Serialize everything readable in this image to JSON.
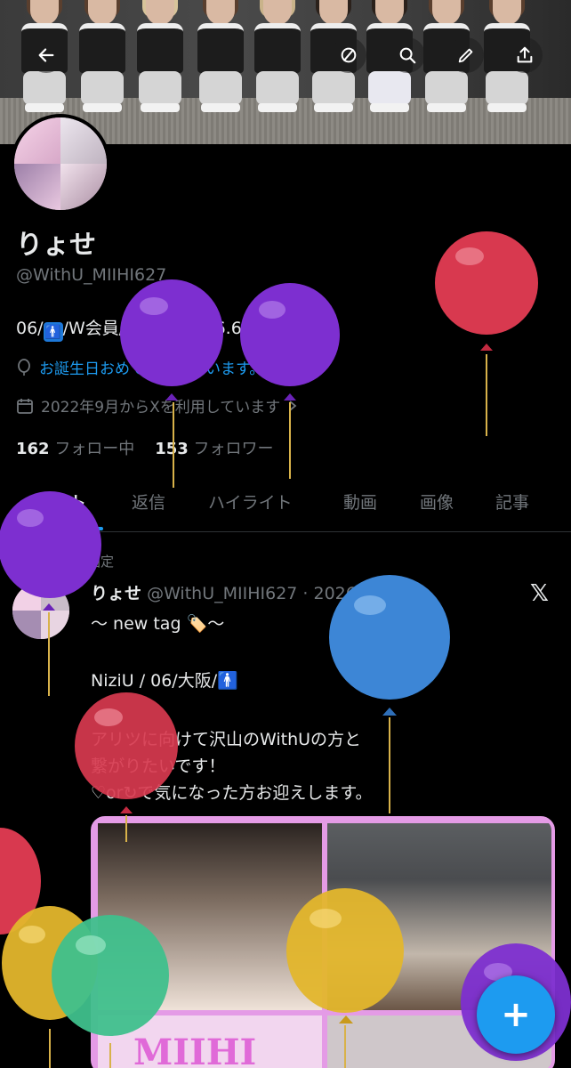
{
  "header": {
    "back_icon": "arrow-left-icon",
    "actions": [
      "mute-icon",
      "search-icon",
      "edit-icon",
      "share-icon"
    ]
  },
  "profile": {
    "display_name": "りょせ",
    "handle": "@WithU_MIIHI627",
    "bio_prefix": "06/",
    "bio_suffix": "/W会員/大阪/京セラ6.6",
    "birthday_text": "お誕生日おめでとうございます。",
    "joined_text": "2022年9月からXを利用しています",
    "following_count": "162",
    "following_label": "フォロー中",
    "followers_count": "153",
    "followers_label": "フォロワー"
  },
  "tabs": [
    "ポスト",
    "返信",
    "ハイライト",
    "動画",
    "画像",
    "記事"
  ],
  "pinned_post": {
    "pinned_label": "固定",
    "author_name": "りょせ",
    "author_meta": "@WithU_MIIHI627 · 2026/01/15",
    "lines": [
      "〜 new tag 🏷️〜",
      "NiziU / 06/大阪/🚹",
      "アリツに向けて沢山のWithUの方と",
      "繋がりたいです！",
      "♡or↻で気になった方お迎えします。"
    ],
    "media_caption": "MIIHI"
  },
  "fab": {
    "label": "+"
  },
  "colors": {
    "accent": "#1d9bf0",
    "background": "#000000",
    "text_secondary": "#71767b",
    "media_border": "#e49be6"
  }
}
